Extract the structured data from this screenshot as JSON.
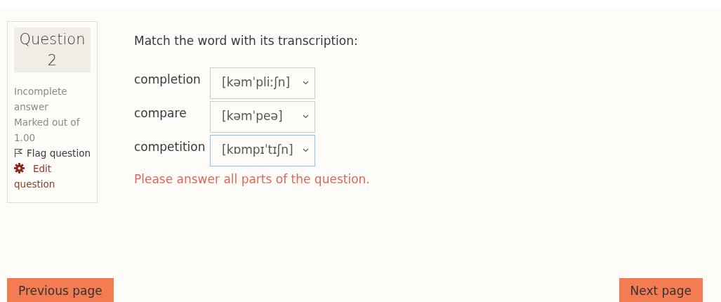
{
  "question_info": {
    "title": "Question 2",
    "state": "Incomplete answer",
    "marks": "Marked out of 1.00",
    "flag_link": "Flag question",
    "edit_link": "Edit question"
  },
  "prompt": "Match the word with its transcription:",
  "matches": [
    {
      "word": "completion",
      "answer": "[kəmˈpliːʃn]",
      "focused": false
    },
    {
      "word": "compare",
      "answer": "[kəmˈpeə]",
      "focused": false
    },
    {
      "word": "competition",
      "answer": "[kɒmpɪˈtɪʃn]",
      "focused": true
    }
  ],
  "validation_error": "Please answer all parts of the question.",
  "navigation": {
    "previous": "Previous page",
    "next": "Next page"
  }
}
